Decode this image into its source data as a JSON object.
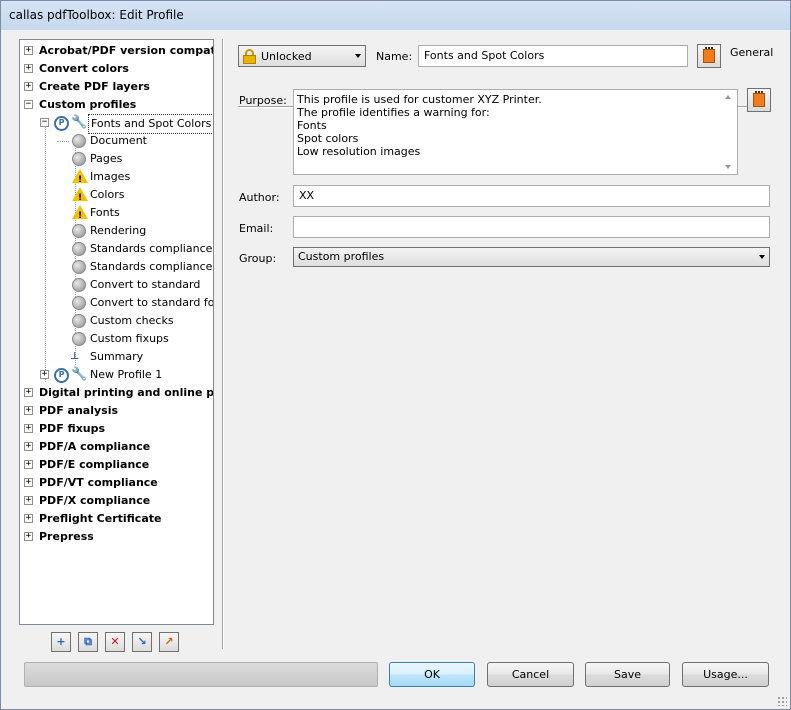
{
  "window": {
    "title": "callas pdfToolbox: Edit Profile"
  },
  "tree": {
    "items": [
      {
        "label": "Acrobat/PDF version compatibility",
        "bold": true
      },
      {
        "label": "Convert colors",
        "bold": true
      },
      {
        "label": "Create PDF layers",
        "bold": true
      },
      {
        "label": "Custom profiles",
        "bold": true
      },
      {
        "label": "Fonts and Spot Colors"
      },
      {
        "label": "Document"
      },
      {
        "label": "Pages"
      },
      {
        "label": "Images"
      },
      {
        "label": "Colors"
      },
      {
        "label": "Fonts"
      },
      {
        "label": "Rendering"
      },
      {
        "label": "Standards compliance"
      },
      {
        "label": "Standards compliance for"
      },
      {
        "label": "Convert to standard"
      },
      {
        "label": "Convert to standard for"
      },
      {
        "label": "Custom checks"
      },
      {
        "label": "Custom fixups"
      },
      {
        "label": "Summary"
      },
      {
        "label": "New Profile 1"
      },
      {
        "label": "Digital printing and online publishing",
        "bold": true
      },
      {
        "label": "PDF analysis",
        "bold": true
      },
      {
        "label": "PDF fixups",
        "bold": true
      },
      {
        "label": "PDF/A compliance",
        "bold": true
      },
      {
        "label": "PDF/E compliance",
        "bold": true
      },
      {
        "label": "PDF/VT compliance",
        "bold": true
      },
      {
        "label": "PDF/X compliance",
        "bold": true
      },
      {
        "label": "Preflight Certificate",
        "bold": true
      },
      {
        "label": "Prepress",
        "bold": true
      }
    ]
  },
  "form": {
    "lock_state": "Unlocked",
    "name_label": "Name:",
    "name_value": "Fonts and Spot Colors",
    "general_label": "General",
    "purpose_label": "Purpose:",
    "purpose_lines": [
      "This profile is used for customer XYZ Printer.",
      "The profile identifies a warning for:",
      "Fonts",
      "Spot colors",
      "Low resolution images"
    ],
    "author_label": "Author:",
    "author_value": "XX",
    "email_label": "Email:",
    "email_value": "",
    "group_label": "Group:",
    "group_value": "Custom profiles"
  },
  "buttons": {
    "ok": "OK",
    "cancel": "Cancel",
    "save": "Save",
    "usage": "Usage..."
  }
}
